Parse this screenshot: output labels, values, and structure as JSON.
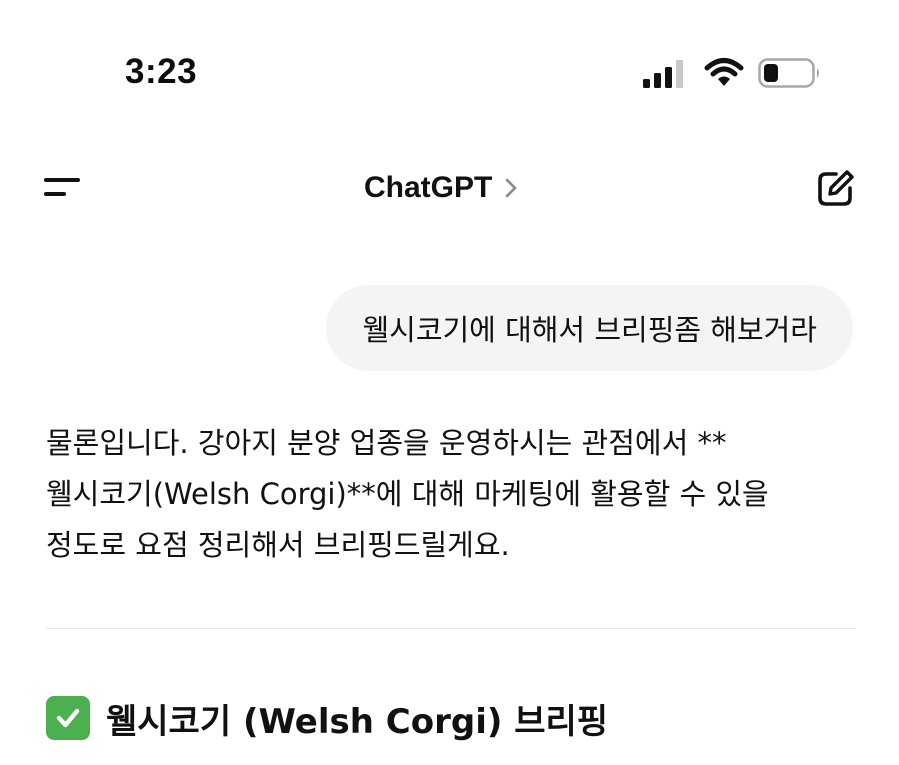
{
  "status_bar": {
    "time": "3:23",
    "icons": [
      "signal-icon",
      "wifi-icon",
      "battery-icon"
    ]
  },
  "nav": {
    "title": "ChatGPT",
    "icons": [
      "menu-icon",
      "chevron-right-icon",
      "new-chat-icon"
    ]
  },
  "messages": {
    "user": "웰시코기에 대해서 브리핑좀 해보거라",
    "assistant_lines": [
      "물론입니다. 강아지 분양 업종을 운영하시는 관점에서 **",
      "웰시코기(Welsh Corgi)**에 대해 마케팅에 활용할 수 있을",
      "정도로 요점 정리해서 브리핑드릴게요."
    ],
    "heading": "웰시코기 (Welsh Corgi) 브리핑"
  },
  "colors": {
    "bubble_bg": "#f4f4f4",
    "check_green": "#4caf50",
    "text": "#111111"
  }
}
